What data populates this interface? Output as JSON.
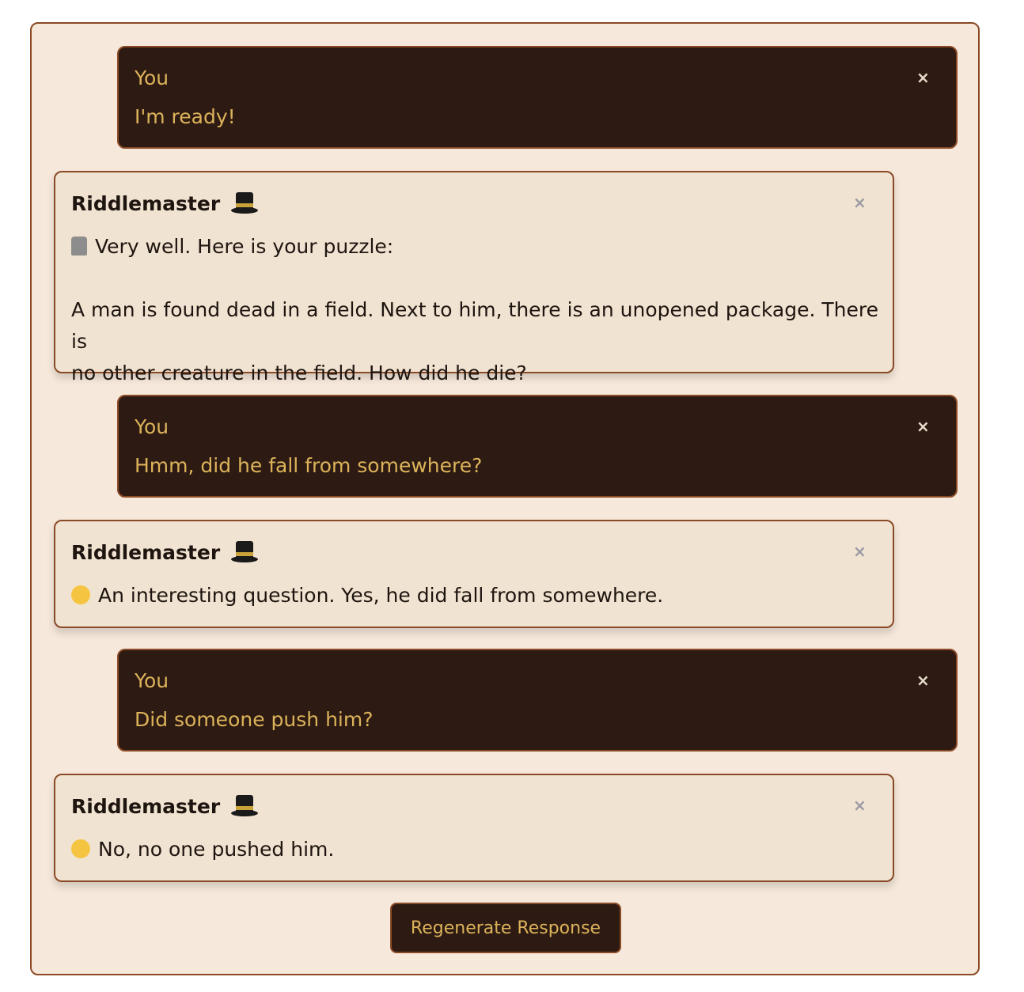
{
  "chat": {
    "messages": [
      {
        "sender": "You",
        "role": "user",
        "lines": [
          "I'm ready!"
        ]
      },
      {
        "sender": "Riddlemaster",
        "role": "bot",
        "sender_icon": "top-hat-icon",
        "lead_icon": "moai-icon",
        "lines": [
          "Very well. Here is your puzzle:",
          "",
          "A man is found dead in a field. Next to him, there is an unopened package. There is",
          "no other creature in the field. How did he die?"
        ]
      },
      {
        "sender": "You",
        "role": "user",
        "lines": [
          "Hmm, did he fall from somewhere?"
        ]
      },
      {
        "sender": "Riddlemaster",
        "role": "bot",
        "sender_icon": "top-hat-icon",
        "lead_icon": "face-with-monocle-icon",
        "lines": [
          "An interesting question. Yes, he did fall from somewhere."
        ]
      },
      {
        "sender": "You",
        "role": "user",
        "lines": [
          "Did someone push him?"
        ]
      },
      {
        "sender": "Riddlemaster",
        "role": "bot",
        "sender_icon": "top-hat-icon",
        "lead_icon": "thinking-face-icon",
        "lines": [
          "No, no one pushed him."
        ]
      }
    ],
    "close_glyph": "×"
  },
  "actions": {
    "regenerate_label": "Regenerate Response"
  },
  "colors": {
    "panel_bg": "#f6e8da",
    "border": "#8a4a26",
    "user_bg": "#2d1a12",
    "user_text": "#dcb35a",
    "bot_bg": "#f1e3d1",
    "bot_text": "#1e1510"
  }
}
